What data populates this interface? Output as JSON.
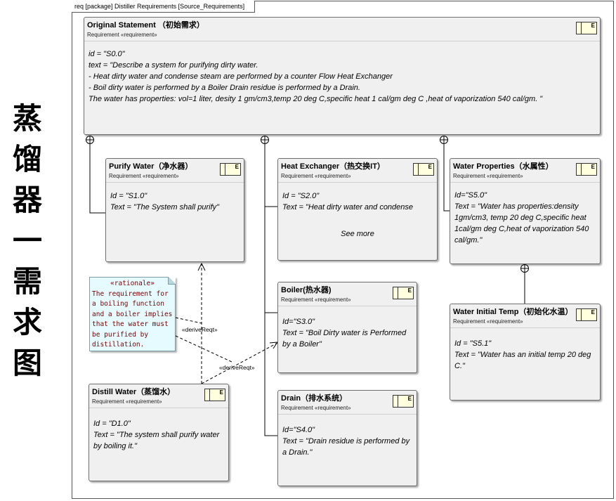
{
  "side_title": [
    "蒸",
    "馏",
    "器",
    "一",
    "需",
    "求",
    "图"
  ],
  "frame_label": "req [package] Distiller Requirements [Source_Requirements]",
  "stereotype_text": "Requirement «requirement»",
  "icon_letter": "E",
  "requirements": {
    "original": {
      "name": "Original Statement （初始需求）",
      "lines": [
        "id = \"S0.0\"",
        "text = \"Describe a system for purifying dirty water.",
        "- Heat dirty water and condense steam are performed by a counter Flow Heat Exchanger",
        "- Boil dirty water is performed by a Boiler Drain residue is performed by a Drain.",
        "The water has properties: vol=1 liter, desity 1 gm/cm3,temp 20 deg C,specific heat 1 cal/gm deg C ,heat of vaporization 540 cal/gm. \""
      ]
    },
    "purify": {
      "name": "Purify Water（净水器）",
      "lines": [
        "Id = \"S1.0\"",
        "Text = \"The System shall purify\""
      ]
    },
    "heat_exchanger": {
      "name": "Heat Exchanger（热交换IT）",
      "lines": [
        "Id = \"S2.0\"",
        "Text = \"Heat dirty water and condense"
      ],
      "more": "See more"
    },
    "water_props": {
      "name": "Water Properties（水属性）",
      "lines": [
        "Id=\"S5.0\"",
        "Text = \"Water has properties:density 1gm/cm3, temp 20 deg C,specific heat 1cal/gm deg C,heat of vaporization 540 cal/gm.\""
      ]
    },
    "boiler": {
      "name": "Boiler(热水器)",
      "lines": [
        "Id=\"S3.0\"",
        "Text = \"Boil Dirty water is Performed by a Boiler\""
      ]
    },
    "water_temp": {
      "name": "Water Initial Temp（初始化水温）",
      "lines": [
        "Id = \"S5.1\"",
        "Text = \"Water has an initial temp 20 deg C.\""
      ]
    },
    "distill": {
      "name": "Distill Water（蒸馏水）",
      "lines": [
        "Id = \"D1.0\"",
        "Text = \"The system shall purify water by boiling it.\""
      ]
    },
    "drain": {
      "name": "Drain（排水系统）",
      "lines": [
        "Id=\"S4.0\"",
        "Text = \"Drain residue is performed by a Drain.\""
      ]
    }
  },
  "rationale": {
    "stereotype": "«rationale»",
    "text": "The requirement for a boiling function and a boiler implies that the water must be purified by distillation."
  },
  "links": {
    "derive1": "«deriveReqt»",
    "derive2": "«deriveReqt»"
  },
  "colors": {
    "box_fill": "#f0f0f0",
    "note_fill": "#e6fbff",
    "note_text": "#7a0000",
    "icon_fill": "#ffffde"
  }
}
